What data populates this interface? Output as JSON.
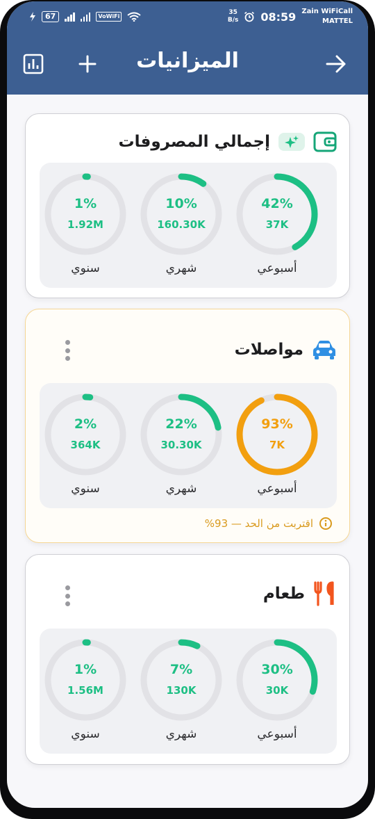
{
  "status_bar": {
    "battery": "67",
    "vowifi": "VoWiFi",
    "speed_value": "35",
    "speed_unit": "B/s",
    "time": "08:59",
    "carrier_line1": "Zain WiFiCall",
    "carrier_line2": "MATTEL"
  },
  "app_bar": {
    "title": "الميزانيات",
    "icons": {
      "stats": "bar-chart-icon",
      "add": "plus-icon",
      "back": "arrow-right-icon"
    }
  },
  "colors": {
    "app_bar": "#3d5f92",
    "green": "#1dbf84",
    "orange": "#f29f0f",
    "track": "#e2e2e6",
    "expense_icon": "#16a678",
    "transport_icon": "#2f8fe3",
    "food_icon": "#f2551e"
  },
  "cards": [
    {
      "id": "total",
      "title": "إجمالي المصروفات",
      "icon": "wallet-icon",
      "badge_icon": "sparkle-icon",
      "rings": [
        {
          "period": "أسبوعي",
          "percent_text": "42%",
          "amount": "37K",
          "fraction": 0.42,
          "status": "ok"
        },
        {
          "period": "شهري",
          "percent_text": "10%",
          "amount": "160.30K",
          "fraction": 0.1,
          "status": "ok"
        },
        {
          "period": "سنوي",
          "percent_text": "1%",
          "amount": "1.92M",
          "fraction": 0.01,
          "status": "ok"
        }
      ]
    },
    {
      "id": "transport",
      "title": "مواصلات",
      "icon": "car-icon",
      "rings": [
        {
          "period": "أسبوعي",
          "percent_text": "93%",
          "amount": "7K",
          "fraction": 0.93,
          "status": "warn"
        },
        {
          "period": "شهري",
          "percent_text": "22%",
          "amount": "30.30K",
          "fraction": 0.22,
          "status": "ok"
        },
        {
          "period": "سنوي",
          "percent_text": "2%",
          "amount": "364K",
          "fraction": 0.02,
          "status": "ok"
        }
      ],
      "warning": "اقتربت من الحد — 93%"
    },
    {
      "id": "food",
      "title": "طعام",
      "icon": "fork-knife-icon",
      "rings": [
        {
          "period": "أسبوعي",
          "percent_text": "30%",
          "amount": "30K",
          "fraction": 0.3,
          "status": "ok"
        },
        {
          "period": "شهري",
          "percent_text": "7%",
          "amount": "130K",
          "fraction": 0.07,
          "status": "ok"
        },
        {
          "period": "سنوي",
          "percent_text": "1%",
          "amount": "1.56M",
          "fraction": 0.01,
          "status": "ok"
        }
      ]
    }
  ]
}
